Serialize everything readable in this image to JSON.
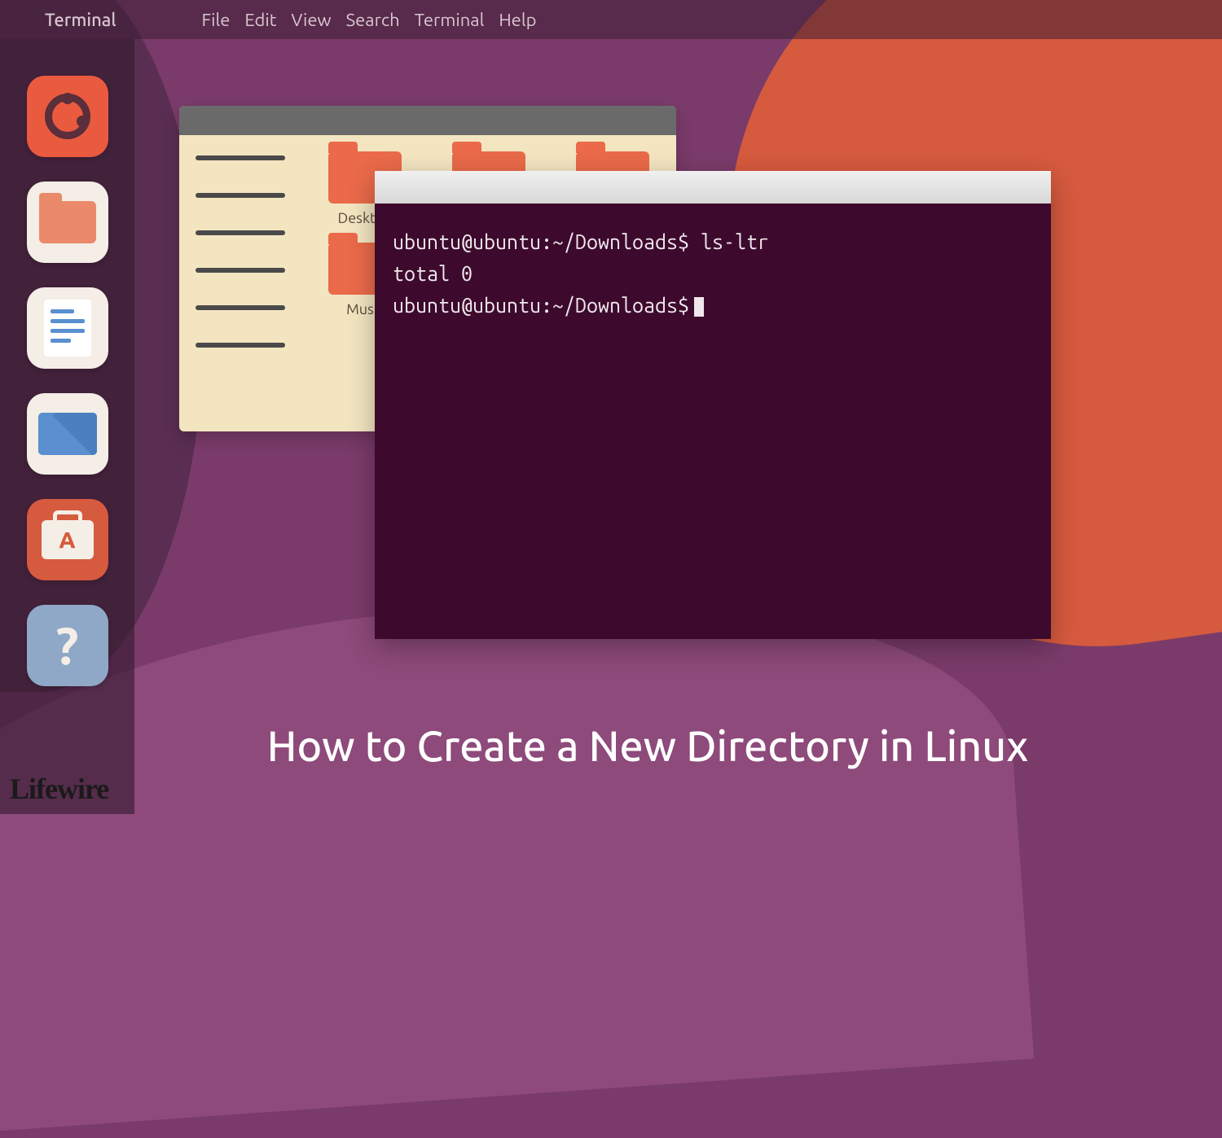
{
  "topbar": {
    "app_name": "Terminal",
    "menus": [
      "File",
      "Edit",
      "View",
      "Search",
      "Terminal",
      "Help"
    ]
  },
  "launcher": {
    "items": [
      {
        "name": "ubuntu-logo-icon"
      },
      {
        "name": "files-icon"
      },
      {
        "name": "document-icon"
      },
      {
        "name": "mail-icon"
      },
      {
        "name": "software-center-icon"
      },
      {
        "name": "help-icon"
      }
    ]
  },
  "file_manager": {
    "folders": [
      {
        "label": "Desktop"
      },
      {
        "label": ""
      },
      {
        "label": ""
      },
      {
        "label": "Music"
      },
      {
        "label": ""
      },
      {
        "label": ""
      }
    ]
  },
  "terminal": {
    "lines": [
      "ubuntu@ubuntu:~/Downloads$ ls-ltr",
      "total 0",
      "ubuntu@ubuntu:~/Downloads$"
    ]
  },
  "caption": "How to Create a New Directory in Linux",
  "watermark": "Lifewire"
}
